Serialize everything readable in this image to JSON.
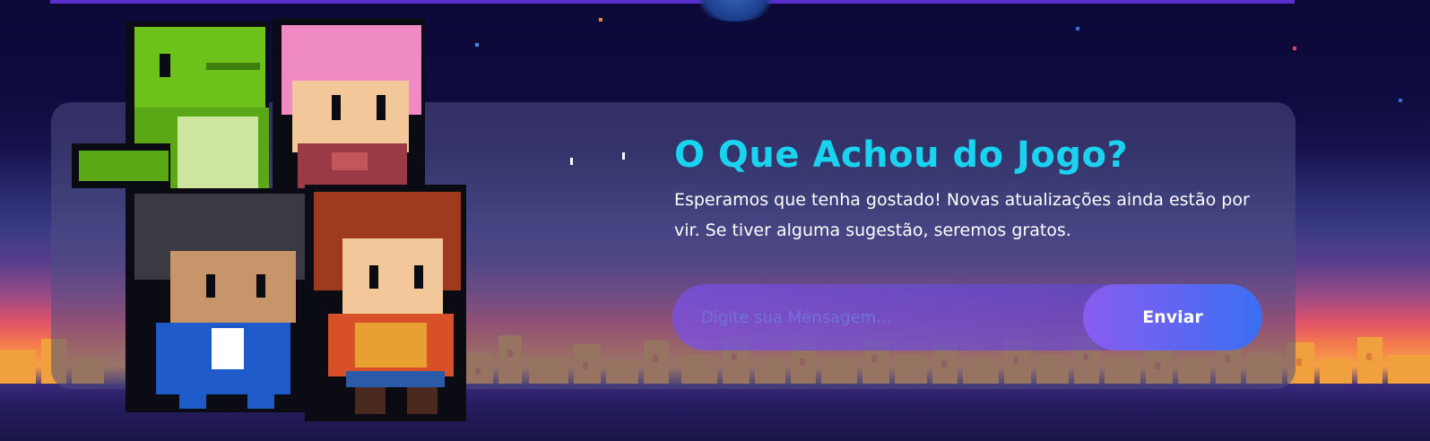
{
  "feedback": {
    "title": "O Que Achou do Jogo?",
    "description": "Esperamos que tenha gostado! Novas atualizações ainda estão por vir. Se tiver alguma sugestão, seremos gratos.",
    "message_placeholder": "Digite sua Mensagem...",
    "send_label": "Enviar"
  },
  "theme": {
    "title_color": "#19d3ef",
    "button_gradient": [
      "#8a5cf0",
      "#3a6ff2"
    ],
    "panel_color": "rgba(78,78,130,0.55)"
  },
  "illustration": {
    "characters": [
      "green-dinosaur",
      "pink-haired-character",
      "dark-haired-boy",
      "red-haired-girl"
    ]
  }
}
